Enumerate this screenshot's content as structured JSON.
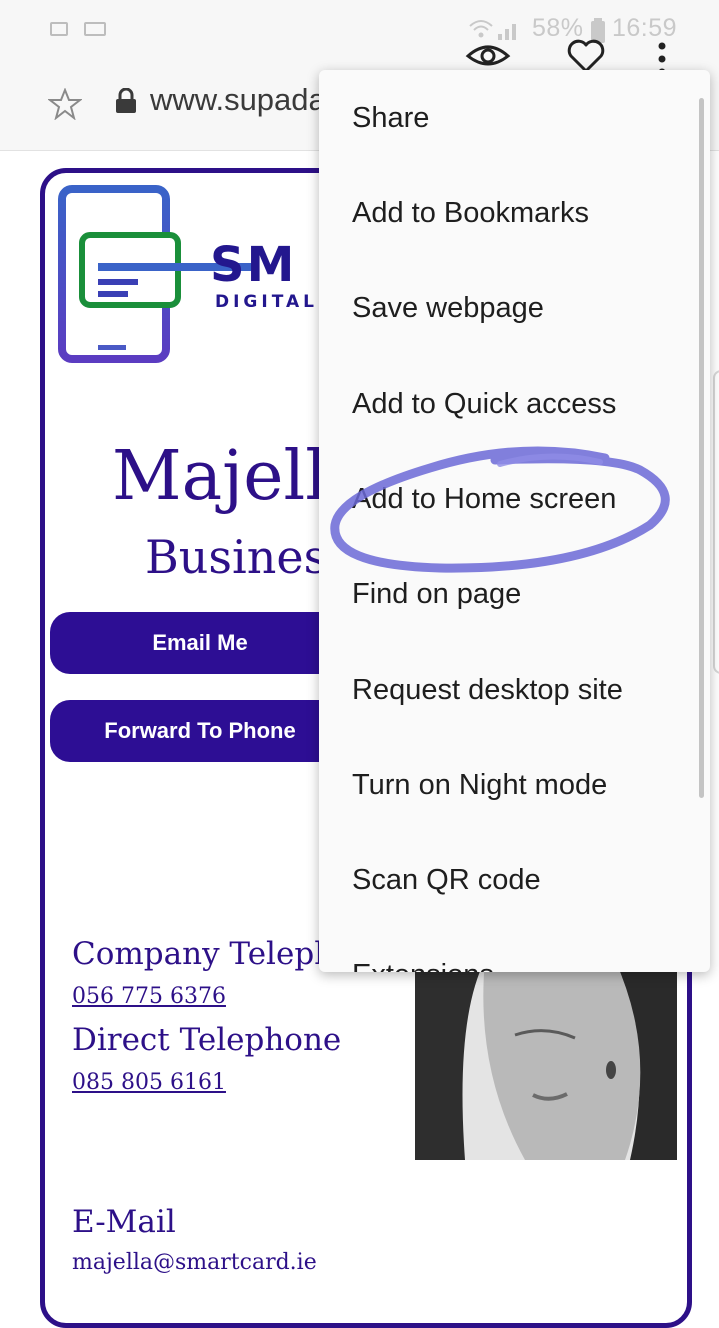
{
  "status_bar": {
    "battery": "58%",
    "time": "16:59"
  },
  "browser": {
    "url": "www.supada"
  },
  "card": {
    "logo_word": "SM",
    "logo_sub": "DIGITAL",
    "name": "Majell",
    "subtitle": "Busines",
    "buttons": {
      "email": "Email Me",
      "forward": "Forward To Phone"
    },
    "company_telephone_label": "Company Teleph",
    "company_telephone": "056 775 6376",
    "direct_telephone_label": "Direct Telephone",
    "direct_telephone": "085 805 6161",
    "email_label": "E-Mail",
    "email": "majella@smartcard.ie"
  },
  "menu": {
    "items": [
      "Share",
      "Add to Bookmarks",
      "Save webpage",
      "Add to Quick access",
      "Add to Home screen",
      "Find on page",
      "Request desktop site",
      "Turn on Night mode",
      "Scan QR code",
      "Extensions"
    ]
  },
  "colors": {
    "brand": "#2d1088",
    "highlight": "#6b68d6"
  }
}
